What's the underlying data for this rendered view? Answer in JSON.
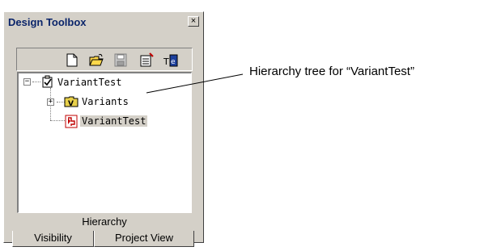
{
  "window": {
    "title": "Design Toolbox",
    "close_glyph": "×"
  },
  "toolbar": {
    "buttons": [
      {
        "name": "new-document-icon"
      },
      {
        "name": "open-folder-icon"
      },
      {
        "name": "save-disk-icon"
      },
      {
        "name": "properties-icon"
      },
      {
        "name": "text-editor-icon"
      }
    ]
  },
  "tree": {
    "root": {
      "label": "VariantTest",
      "expander": "−",
      "icon": "checklist-icon"
    },
    "child_folder": {
      "label": "Variants",
      "expander": "+",
      "icon": "folder-v-icon"
    },
    "child_item": {
      "label": "VariantTest",
      "icon": "schematic-icon",
      "selected": true
    }
  },
  "tabs": {
    "active": "Hierarchy",
    "bottom": [
      "Visibility",
      "Project View"
    ]
  },
  "callout": {
    "text": "Hierarchy tree for “VariantTest”"
  },
  "colors": {
    "panel": "#d4d0c8",
    "title_text": "#0a246a",
    "selection": "#d4d0c8"
  }
}
